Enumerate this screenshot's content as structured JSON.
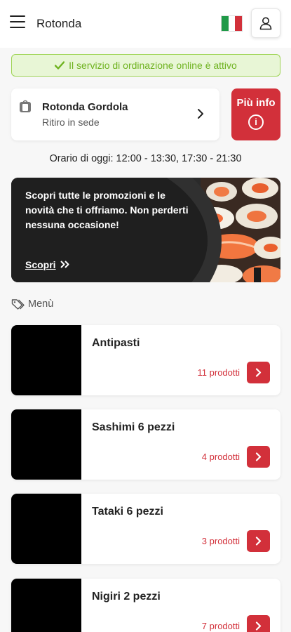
{
  "header": {
    "title": "Rotonda",
    "menu_icon": "hamburger-icon",
    "language_flag": "italy-flag",
    "user_icon": "user-icon"
  },
  "status": {
    "text": "Il servizio di ordinazione online è attivo",
    "color": "#6fb320",
    "icon": "check-icon"
  },
  "location": {
    "store_name": "Rotonda Gordola",
    "mode": "Ritiro in sede",
    "icon": "store-bag-icon"
  },
  "info_button": {
    "label": "Più info",
    "icon": "info-icon"
  },
  "hours": "Orario di oggi: 12:00 - 13:30, 17:30 - 21:30",
  "promo": {
    "text": "Scopri tutte le promozioni e le novità che ti offriamo. Non perderti nessuna occasione!",
    "link_label": "Scopri",
    "link_icon": "double-chevron-right-icon"
  },
  "menu": {
    "label": "Menù",
    "icon": "tags-icon",
    "categories": [
      {
        "title": "Antipasti",
        "count": "11 prodotti"
      },
      {
        "title": "Sashimi 6 pezzi",
        "count": "4 prodotti"
      },
      {
        "title": "Tataki 6 pezzi",
        "count": "3 prodotti"
      },
      {
        "title": "Nigiri 2 pezzi",
        "count": "7 prodotti"
      }
    ]
  },
  "colors": {
    "accent": "#d2303a",
    "status_bg": "#e8f6d6",
    "status_border": "#9ed454"
  }
}
